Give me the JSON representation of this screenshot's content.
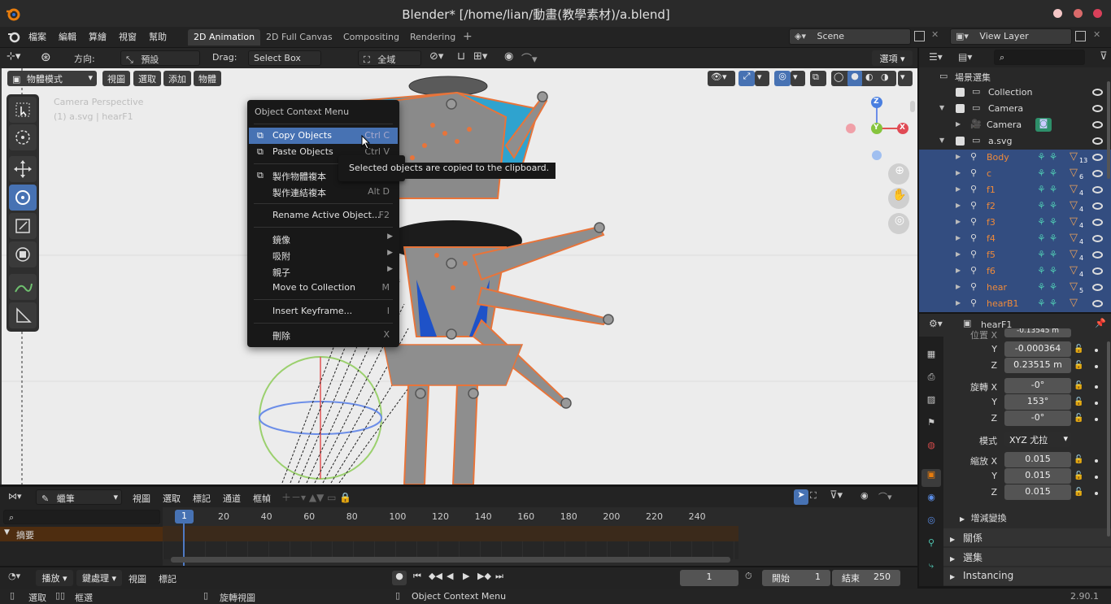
{
  "window": {
    "title": "Blender* [/home/lian/動畫(教學素材)/a.blend]"
  },
  "topmenu": {
    "items": [
      "檔案",
      "編輯",
      "算繪",
      "視窗",
      "幫助"
    ]
  },
  "workspaces": {
    "tabs": [
      "2D Animation",
      "2D Full Canvas",
      "Compositing",
      "Rendering"
    ]
  },
  "scene": {
    "name": "Scene",
    "view_layer": "View Layer"
  },
  "tool_header": {
    "orientation_label": "方向:",
    "orientation_value": "預設",
    "drag_label": "Drag:",
    "drag_value": "Select Box",
    "pivot_value": "全域",
    "options": "選項"
  },
  "viewport_header": {
    "mode": "物體模式",
    "menus": [
      "視圖",
      "選取",
      "添加",
      "物體"
    ]
  },
  "viewport": {
    "camera_label": "Camera Perspective",
    "object_label": "(1) a.svg | hearF1",
    "gizmo_x": "X",
    "gizmo_y": "Y",
    "gizmo_z": "Z"
  },
  "context_menu": {
    "title": "Object Context Menu",
    "items": [
      {
        "label": "Copy Objects",
        "shortcut": "Ctrl C"
      },
      {
        "label": "Paste Objects",
        "shortcut": "Ctrl V"
      },
      {
        "label": "製作物體複本",
        "shortcut": ""
      },
      {
        "label": "製作連結複本",
        "shortcut": "Alt D"
      },
      {
        "label": "Rename Active Object...",
        "shortcut": "F2"
      },
      {
        "label": "鏡像",
        "shortcut": ""
      },
      {
        "label": "吸附",
        "shortcut": ""
      },
      {
        "label": "親子",
        "shortcut": ""
      },
      {
        "label": "Move to Collection",
        "shortcut": "M"
      },
      {
        "label": "Insert Keyframe...",
        "shortcut": "I"
      },
      {
        "label": "刪除",
        "shortcut": "X"
      }
    ]
  },
  "tooltip": {
    "text": "Selected objects are copied to the clipboard."
  },
  "outliner": {
    "root": "場景選集",
    "rows": [
      {
        "label": "Collection",
        "badge": ""
      },
      {
        "label": "Camera",
        "badge": ""
      },
      {
        "label": "Camera",
        "badge": ""
      },
      {
        "label": "a.svg",
        "badge": ""
      },
      {
        "label": "Body",
        "badge": "13"
      },
      {
        "label": "c",
        "badge": "6"
      },
      {
        "label": "f1",
        "badge": "4"
      },
      {
        "label": "f2",
        "badge": "4"
      },
      {
        "label": "f3",
        "badge": "4"
      },
      {
        "label": "f4",
        "badge": "4"
      },
      {
        "label": "f5",
        "badge": "4"
      },
      {
        "label": "f6",
        "badge": "4"
      },
      {
        "label": "hear",
        "badge": "5"
      },
      {
        "label": "hearB1",
        "badge": ""
      }
    ]
  },
  "properties": {
    "object_name": "hearF1",
    "location_label": "位置 X",
    "loc_x_partial": "-0.13545 m",
    "loc_y": "-0.000364",
    "loc_z": "0.23515 m",
    "rotation_label": "旋轉 X",
    "rot_x": "-0°",
    "rot_y": "153°",
    "rot_z": "-0°",
    "mode_label": "模式",
    "mode_value": "XYZ 尤拉",
    "scale_label": "縮放 X",
    "scale_x": "0.015",
    "scale_y": "0.015",
    "scale_z": "0.015",
    "axis_y": "Y",
    "axis_z": "Z",
    "delta": "增減變換",
    "panels": [
      "關係",
      "選集",
      "Instancing"
    ]
  },
  "timeline_header": {
    "mode": "蠟筆",
    "menus": [
      "視圖",
      "選取",
      "標記",
      "通道",
      "框幀"
    ]
  },
  "timeline": {
    "summary": "摘要",
    "current_frame_marker": "1",
    "frame_ticks": [
      "20",
      "40",
      "60",
      "80",
      "100",
      "120",
      "140",
      "160",
      "180",
      "200",
      "220",
      "240"
    ]
  },
  "playback": {
    "menus": [
      "播放",
      "鍵處理",
      "視圖",
      "標記"
    ],
    "current_frame": "1",
    "start_label": "開始",
    "start": "1",
    "end_label": "結束",
    "end": "250"
  },
  "statusbar": {
    "select": "選取",
    "box_select": "框選",
    "rotate_view": "旋轉視圖",
    "context_menu": "Object Context Menu",
    "version": "2.90.1"
  }
}
